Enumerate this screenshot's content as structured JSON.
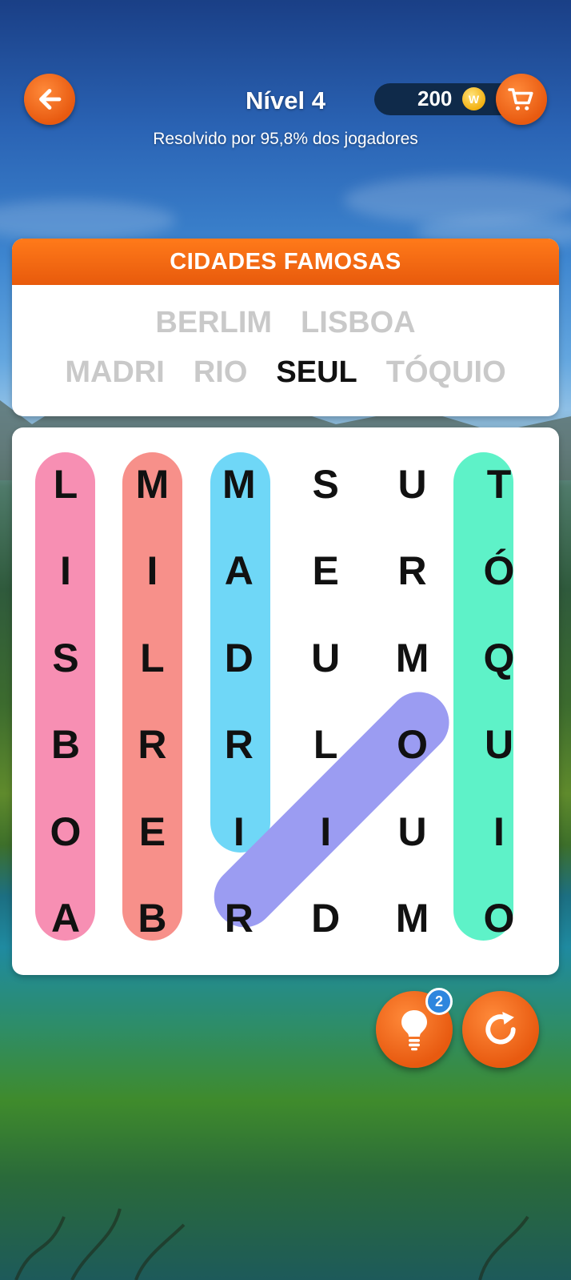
{
  "header": {
    "back_icon": "arrow-left-icon",
    "level_title": "Nível 4",
    "subtitle": "Resolvido por 95,8% dos jogadores",
    "coins": "200",
    "coin_symbol": "W",
    "cart_icon": "shopping-cart-icon"
  },
  "category": {
    "title": "CIDADES FAMOSAS"
  },
  "word_list": {
    "row1": [
      {
        "text": "BERLIM",
        "state": "pending"
      },
      {
        "text": "LISBOA",
        "state": "pending"
      }
    ],
    "row2": [
      {
        "text": "MADRI",
        "state": "pending"
      },
      {
        "text": "RIO",
        "state": "pending"
      },
      {
        "text": "SEUL",
        "state": "active"
      },
      {
        "text": "TÓQUIO",
        "state": "pending"
      }
    ]
  },
  "grid": {
    "rows": [
      [
        "L",
        "M",
        "M",
        "S",
        "U",
        "T"
      ],
      [
        "I",
        "I",
        "A",
        "E",
        "R",
        "Ó"
      ],
      [
        "S",
        "L",
        "D",
        "U",
        "M",
        "Q"
      ],
      [
        "B",
        "R",
        "R",
        "L",
        "O",
        "U"
      ],
      [
        "O",
        "E",
        "I",
        "I",
        "U",
        "I"
      ],
      [
        "A",
        "B",
        "R",
        "D",
        "M",
        "O"
      ]
    ]
  },
  "colors": {
    "accent": "#f06a1a",
    "highlight_pink": "#f78fb3",
    "highlight_salmon": "#f7908a",
    "highlight_cyan": "#6fd7f7",
    "highlight_violet": "#9b9cf2",
    "highlight_mint": "#5ef2c8",
    "word_pending": "#c9c9c9",
    "word_active": "#111111"
  },
  "controls": {
    "hint_icon": "lightbulb-icon",
    "hint_count": "2",
    "restart_icon": "restart-icon"
  }
}
